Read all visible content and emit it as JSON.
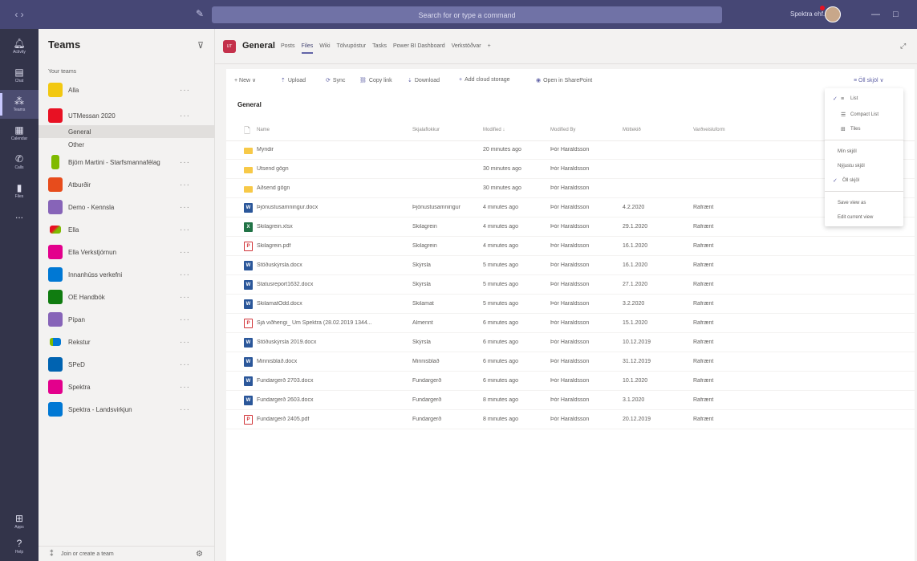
{
  "topbar": {
    "search_placeholder": "Search for or type a command",
    "user_name": "Spektra ehf.",
    "minimize": "—",
    "maximize": "□"
  },
  "rail": [
    {
      "label": "Activity",
      "icon": "bell-icon"
    },
    {
      "label": "Chat",
      "icon": "chat-icon"
    },
    {
      "label": "Teams",
      "icon": "teams-icon",
      "active": true
    },
    {
      "label": "Calendar",
      "icon": "calendar-icon"
    },
    {
      "label": "Calls",
      "icon": "phone-icon"
    },
    {
      "label": "Files",
      "icon": "file-icon"
    },
    {
      "label": "...",
      "icon": "more-icon"
    },
    {
      "label": "Apps",
      "icon": "apps-icon"
    },
    {
      "label": "Help",
      "icon": "help-icon"
    }
  ],
  "teams_panel": {
    "title": "Teams",
    "your_teams": "Your teams",
    "teams": [
      {
        "name": "Alla",
        "color": "#f2c811",
        "more": "···"
      },
      {
        "name": "UTMessan 2020",
        "color": "#e81123",
        "more": "···"
      },
      {
        "name": "Björn Martini - Starfsmannafélag",
        "color": "#7fba00",
        "more": "···"
      },
      {
        "name": "Atburðir",
        "color": "#e74c1c",
        "more": "···"
      },
      {
        "name": "Demo - Kennsla",
        "color": "#8764b8",
        "more": "···"
      },
      {
        "name": "Ella",
        "color": "#ffffff",
        "more": "···"
      },
      {
        "name": "Ella Verkstjórnun",
        "color": "#e3008c",
        "more": "···"
      },
      {
        "name": "Innanhúss verkefni",
        "color": "#0078d4",
        "more": "···"
      },
      {
        "name": "OE Handbók",
        "color": "#107c10",
        "more": "···"
      },
      {
        "name": "Pípan",
        "color": "#8764b8",
        "more": "···"
      },
      {
        "name": "Rekstur",
        "color": "#ffffff",
        "more": "···"
      },
      {
        "name": "SPeD",
        "color": "#0063b1",
        "more": "···"
      },
      {
        "name": "Spektra",
        "color": "#e3008c",
        "more": "···"
      },
      {
        "name": "Spektra - Landsvirkjun",
        "color": "#0078d4",
        "more": "···"
      }
    ],
    "channels": [
      "General",
      "Other"
    ],
    "join_label": "Join or create a team"
  },
  "channel": {
    "title": "General",
    "tabs": [
      "Posts",
      "Files",
      "Wiki",
      "Tölvupóstur",
      "Tasks",
      "Power BI Dashboard",
      "Verkstöðvar",
      "+"
    ],
    "active_tab": "Files",
    "avatar_label": "UT"
  },
  "commands": {
    "new": "+ New ∨",
    "upload": "Upload",
    "sync": "Sync",
    "copy_link": "Copy link",
    "download": "Download",
    "add_cloud": "Add cloud storage",
    "open_sharepoint": "Open in SharePoint",
    "view_switch": "Öll skjöl ∨"
  },
  "breadcrumb": "General",
  "table": {
    "headers": [
      "Name",
      "Skjalaflokkur",
      "Modified ↓",
      "Modified By",
      "Móttekið",
      "Varðveisluform"
    ],
    "rows": [
      {
        "type": "folder",
        "name": "Myndir",
        "cat": "",
        "modified": "20 minutes ago",
        "by": "Þór Haraldsson",
        "date": "",
        "form": ""
      },
      {
        "type": "folder",
        "name": "Útsend gögn",
        "cat": "",
        "modified": "30 minutes ago",
        "by": "Þór Haraldsson",
        "date": "",
        "form": ""
      },
      {
        "type": "folder",
        "name": "Aðsend gögn",
        "cat": "",
        "modified": "30 minutes ago",
        "by": "Þór Haraldsson",
        "date": "",
        "form": ""
      },
      {
        "type": "word",
        "name": "Þjónustusamningur.docx",
        "cat": "Þjónustusamningur",
        "modified": "4 minutes ago",
        "by": "Þór Haraldsson",
        "date": "4.2.2020",
        "form": "Rafrænt"
      },
      {
        "type": "excel",
        "name": "Skilagrein.xlsx",
        "cat": "Skilagrein",
        "modified": "4 minutes ago",
        "by": "Þór Haraldsson",
        "date": "29.1.2020",
        "form": "Rafrænt"
      },
      {
        "type": "pdf",
        "name": "Skilagrein.pdf",
        "cat": "Skilagrein",
        "modified": "4 minutes ago",
        "by": "Þór Haraldsson",
        "date": "16.1.2020",
        "form": "Rafrænt"
      },
      {
        "type": "word",
        "name": "Stöðuskýrsla.docx",
        "cat": "Skýrsla",
        "modified": "5 minutes ago",
        "by": "Þór Haraldsson",
        "date": "16.1.2020",
        "form": "Rafrænt"
      },
      {
        "type": "word",
        "name": "Statusreport1632.docx",
        "cat": "Skýrsla",
        "modified": "5 minutes ago",
        "by": "Þór Haraldsson",
        "date": "27.1.2020",
        "form": "Rafrænt"
      },
      {
        "type": "word",
        "name": "SkilamatOdd.docx",
        "cat": "Skilamat",
        "modified": "5 minutes ago",
        "by": "Þór Haraldsson",
        "date": "3.2.2020",
        "form": "Rafrænt"
      },
      {
        "type": "pdf",
        "name": "Sjá viðhengi_ Um Spektra (28.02.2019 1344...",
        "cat": "Almennt",
        "modified": "6 minutes ago",
        "by": "Þór Haraldsson",
        "date": "15.1.2020",
        "form": "Rafrænt"
      },
      {
        "type": "word",
        "name": "Stöðuskýrsla 2019.docx",
        "cat": "Skýrsla",
        "modified": "6 minutes ago",
        "by": "Þór Haraldsson",
        "date": "10.12.2019",
        "form": "Rafrænt"
      },
      {
        "type": "word",
        "name": "Minnisblað.docx",
        "cat": "Minnisblað",
        "modified": "6 minutes ago",
        "by": "Þór Haraldsson",
        "date": "31.12.2019",
        "form": "Rafrænt"
      },
      {
        "type": "word",
        "name": "Fundargerð 2703.docx",
        "cat": "Fundargerð",
        "modified": "6 minutes ago",
        "by": "Þór Haraldsson",
        "date": "10.1.2020",
        "form": "Rafrænt"
      },
      {
        "type": "word",
        "name": "Fundargerð 2603.docx",
        "cat": "Fundargerð",
        "modified": "8 minutes ago",
        "by": "Þór Haraldsson",
        "date": "3.1.2020",
        "form": "Rafrænt"
      },
      {
        "type": "pdf",
        "name": "Fundargerð 2405.pdf",
        "cat": "Fundargerð",
        "modified": "8 minutes ago",
        "by": "Þór Haraldsson",
        "date": "20.12.2019",
        "form": "Rafrænt"
      }
    ]
  },
  "view_menu": {
    "layout": [
      {
        "label": "List",
        "icon": "list-icon",
        "checked": true
      },
      {
        "label": "Compact List",
        "icon": "compact-list-icon",
        "checked": false
      },
      {
        "label": "Tiles",
        "icon": "tiles-icon",
        "checked": false
      }
    ],
    "views": [
      {
        "label": "Mín skjöl",
        "checked": false
      },
      {
        "label": "Nýjustu skjöl",
        "checked": false
      },
      {
        "label": "Öll skjöl",
        "checked": true
      }
    ],
    "actions": [
      "Save view as",
      "Edit current view"
    ]
  }
}
